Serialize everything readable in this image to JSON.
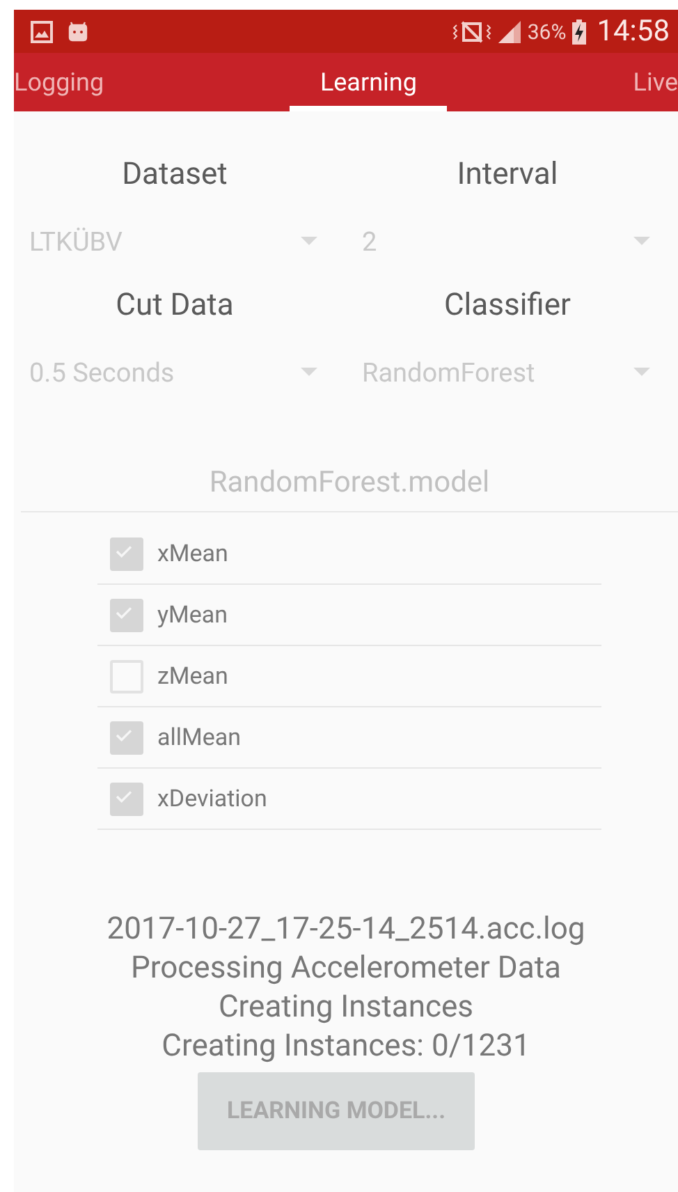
{
  "status_bar": {
    "battery_percent": "36%",
    "time": "14:58"
  },
  "tabs": [
    {
      "label": "Logging",
      "selected": false
    },
    {
      "label": "Learning",
      "selected": true
    },
    {
      "label": "Live",
      "selected": false
    }
  ],
  "settings": [
    {
      "label": "Dataset",
      "value": "LTKÜBV"
    },
    {
      "label": "Interval",
      "value": "2"
    },
    {
      "label": "Cut Data",
      "value": "0.5 Seconds"
    },
    {
      "label": "Classifier",
      "value": "RandomForest"
    }
  ],
  "model_name": {
    "placeholder": "RandomForest.model"
  },
  "features": [
    {
      "label": "xMean",
      "checked": true
    },
    {
      "label": "yMean",
      "checked": true
    },
    {
      "label": "zMean",
      "checked": false
    },
    {
      "label": "allMean",
      "checked": true
    },
    {
      "label": "xDeviation",
      "checked": true
    }
  ],
  "log_lines": [
    "2017-10-27_17-25-14_2514.acc.log",
    "Processing Accelerometer Data",
    "Creating Instances",
    "Creating Instances: 0/1231"
  ],
  "learn_button": {
    "label": "LEARNING MODEL...",
    "disabled": true
  }
}
